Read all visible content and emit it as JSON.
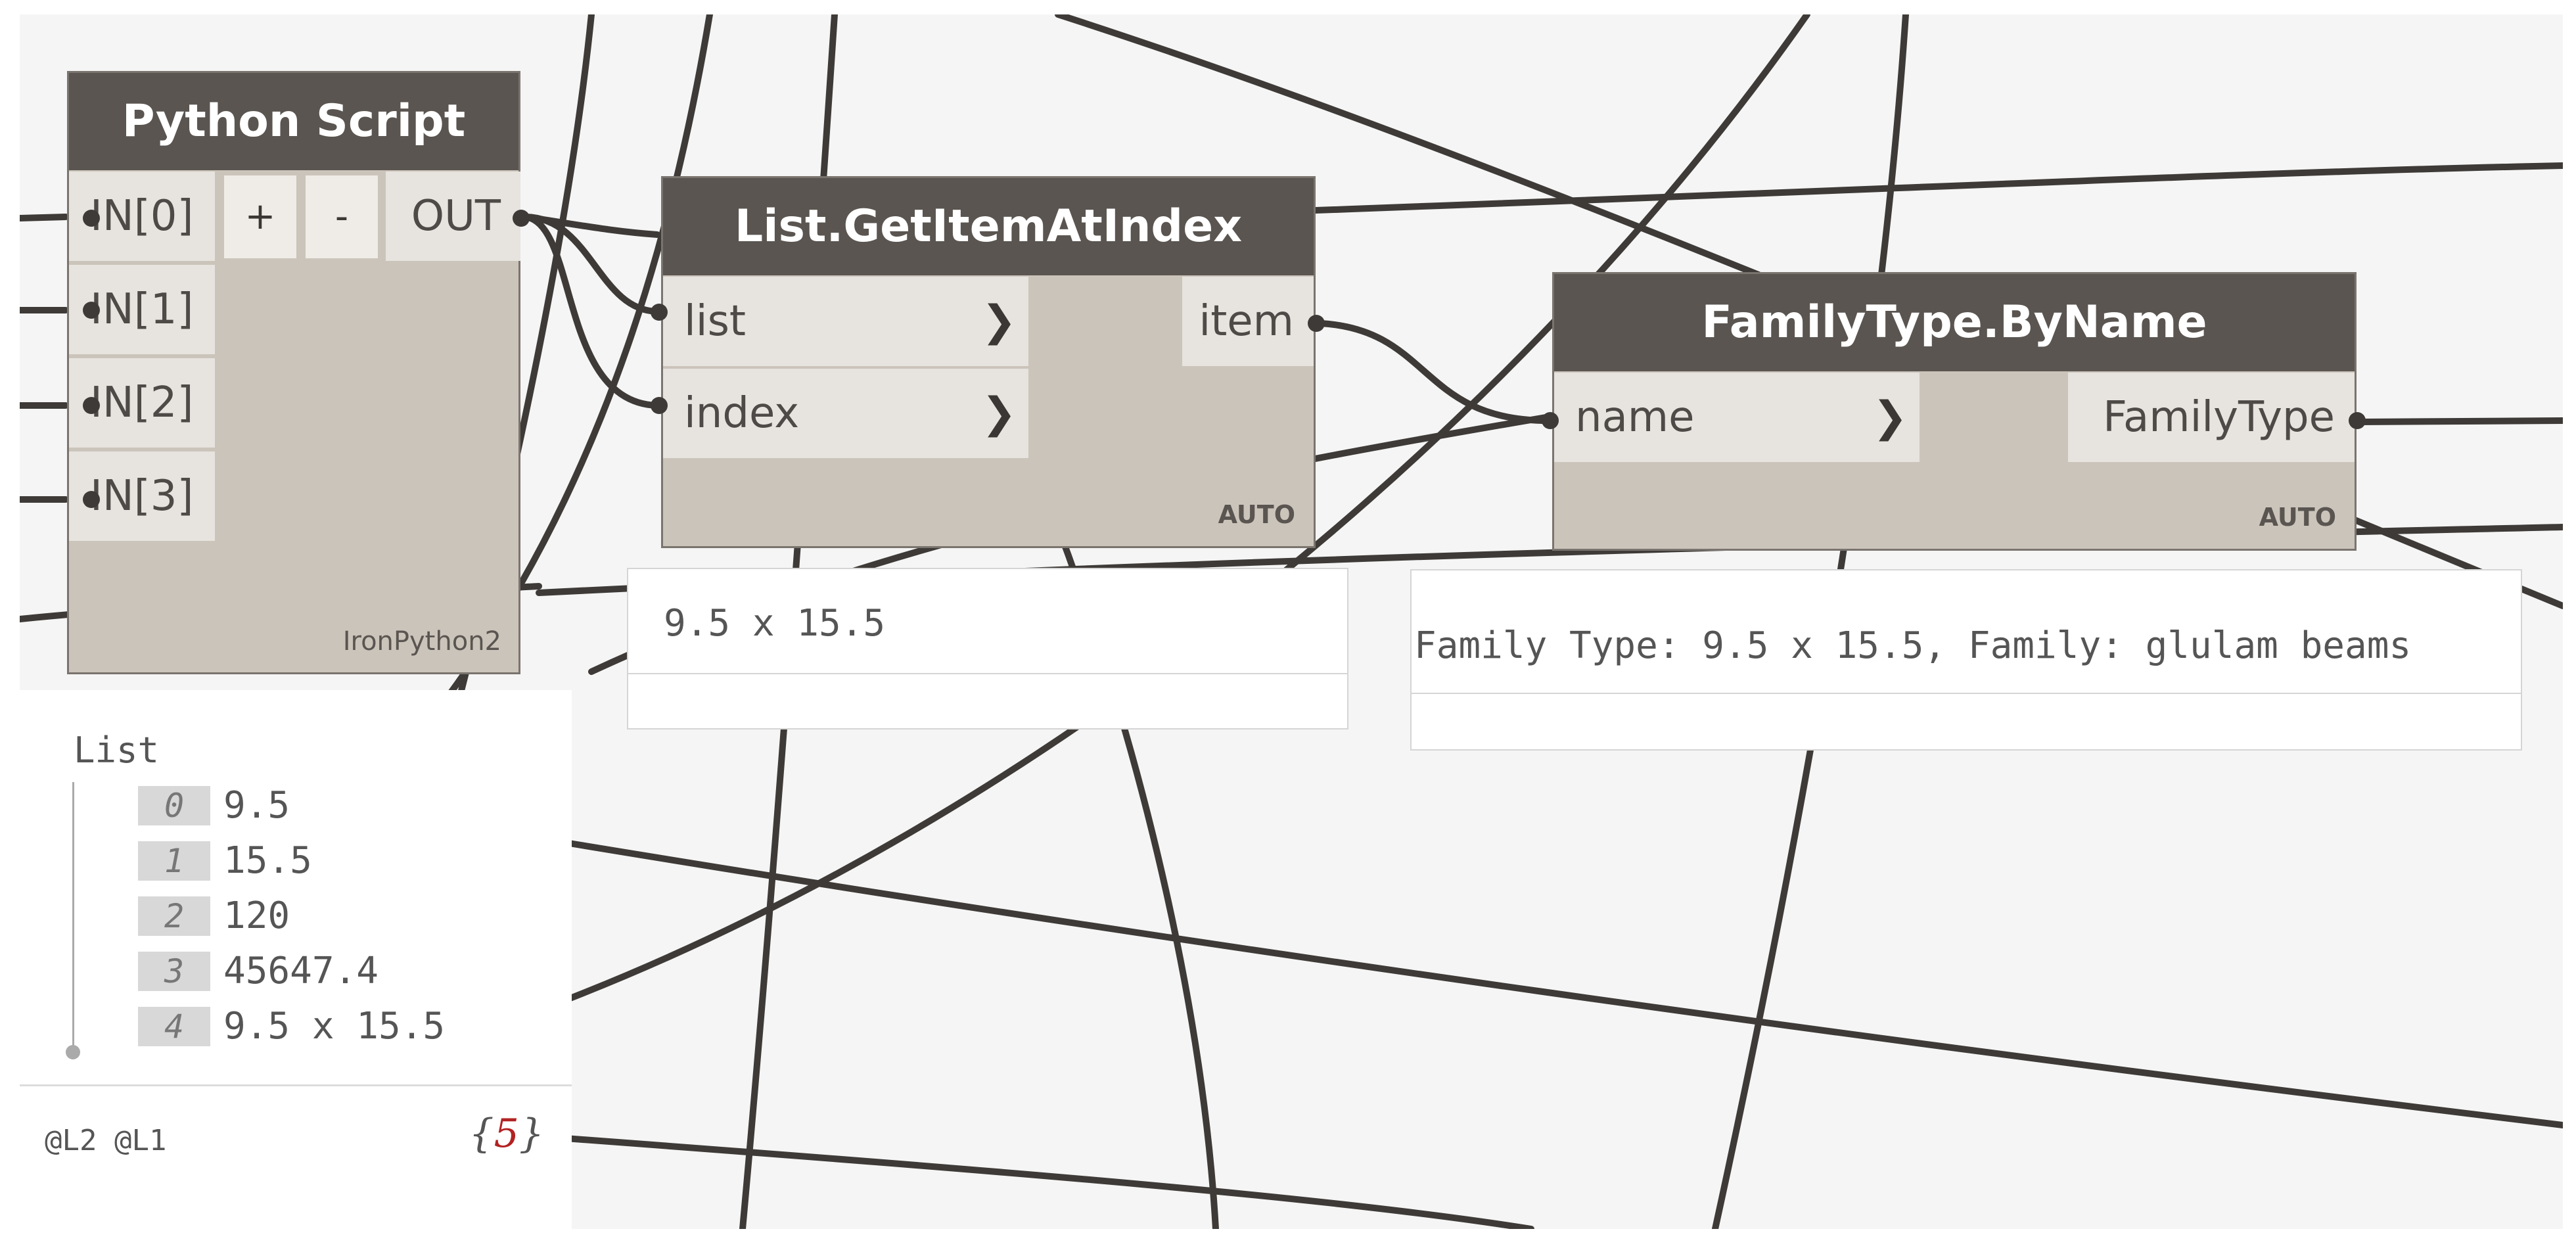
{
  "python_node": {
    "title": "Python Script",
    "inputs": [
      "IN[0]",
      "IN[1]",
      "IN[2]",
      "IN[3]"
    ],
    "add_label": "+",
    "remove_label": "-",
    "output": "OUT",
    "engine": "IronPython2"
  },
  "getitem_node": {
    "title": "List.GetItemAtIndex",
    "inputs": [
      "list",
      "index"
    ],
    "output": "item",
    "lacing": "AUTO",
    "preview": "9.5 x 15.5"
  },
  "familytype_node": {
    "title": "FamilyType.ByName",
    "inputs": [
      "name"
    ],
    "output": "FamilyType",
    "lacing": "AUTO",
    "preview": "Family Type: 9.5 x 15.5, Family: glulam beams"
  },
  "list_preview": {
    "title": "List",
    "items": [
      {
        "index": "0",
        "value": "9.5"
      },
      {
        "index": "1",
        "value": "15.5"
      },
      {
        "index": "2",
        "value": "120"
      },
      {
        "index": "3",
        "value": "45647.4"
      },
      {
        "index": "4",
        "value": "9.5 x 15.5"
      }
    ],
    "levels": "@L2 @L1",
    "count_open": "{",
    "count": "5",
    "count_close": "}"
  },
  "colors": {
    "canvas": "#f5f5f5",
    "node_body": "#cbc4bb",
    "node_header": "#5a5550",
    "port": "#e7e3de",
    "wire": "#3e3a37"
  }
}
